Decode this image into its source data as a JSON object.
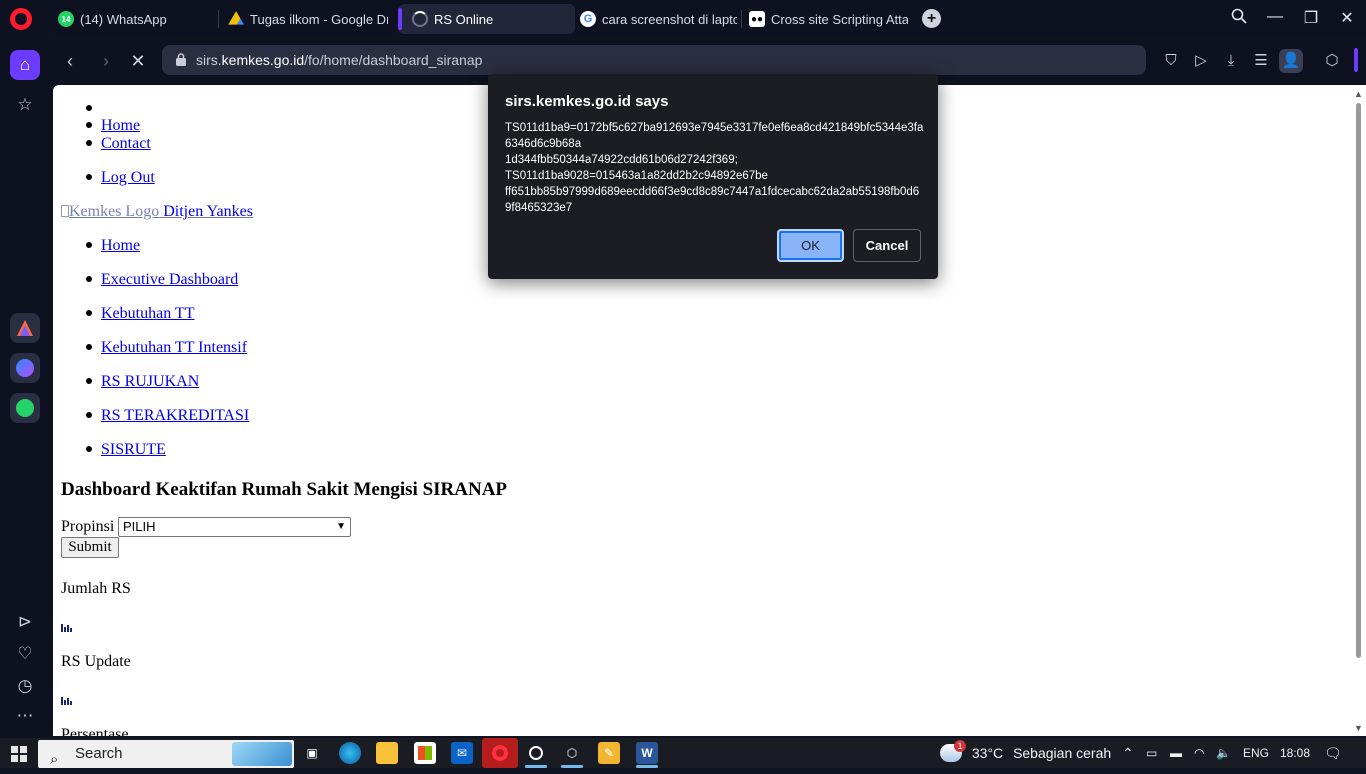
{
  "browser": {
    "tabs": [
      {
        "label": "(14) WhatsApp",
        "badge": "14",
        "icon": "whatsapp-icon",
        "color": "#25d366"
      },
      {
        "label": "Tugas ilkom - Google Drive",
        "icon": "google-drive-icon",
        "color": "#fbbc04"
      },
      {
        "label": "RS Online",
        "icon": "loading-icon",
        "color": "#6b3cff",
        "active": true
      },
      {
        "label": "cara screenshot di laptop",
        "icon": "google-icon",
        "color": "#ffffff"
      },
      {
        "label": "Cross site Scripting Attack",
        "icon": "medium-icon",
        "color": "#ffffff"
      }
    ],
    "url_domain": "sirs.kemkes.go.id",
    "url_prefix": "sirs.",
    "url_host": "kemkes.go.id",
    "url_path": "/fo/home/dashboard_siranap"
  },
  "page": {
    "top_nav": [
      "Home",
      "Contact",
      "Log Out"
    ],
    "logo_alt": "Kemkes Logo",
    "brand": "Ditjen Yankes",
    "menu": [
      "Home",
      "Executive Dashboard",
      "Kebutuhan TT",
      "Kebutuhan TT Intensif",
      "RS RUJUKAN",
      "RS TERAKREDITASI",
      "SISRUTE"
    ],
    "heading": "Dashboard Keaktifan Rumah Sakit Mengisi SIRANAP",
    "propinsi_label": "Propinsi",
    "propinsi_selected": "PILIH",
    "submit_label": "Submit",
    "stats": [
      "Jumlah RS",
      "RS Update",
      "Persentase"
    ]
  },
  "dialog": {
    "title": "sirs.kemkes.go.id says",
    "message": "TS011d1ba9=0172bf5c627ba912693e7945e3317fe0ef6ea8cd421849bfc5344e3fa6346d6c9b68a\n1d344fbb50344a74922cdd61b06d27242f369;\nTS011d1ba9028=015463a1a82dd2b2c94892e67be\nff651bb85b97999d689eecdd66f3e9cd8c89c7447a1fdcecabc62da2ab55198fb0d69f8465323e7",
    "ok_label": "OK",
    "cancel_label": "Cancel"
  },
  "taskbar": {
    "search_placeholder": "Search",
    "weather_badge": "1",
    "temperature": "33°C",
    "weather_text": "Sebagian cerah",
    "language": "ENG",
    "time": "18:08"
  }
}
